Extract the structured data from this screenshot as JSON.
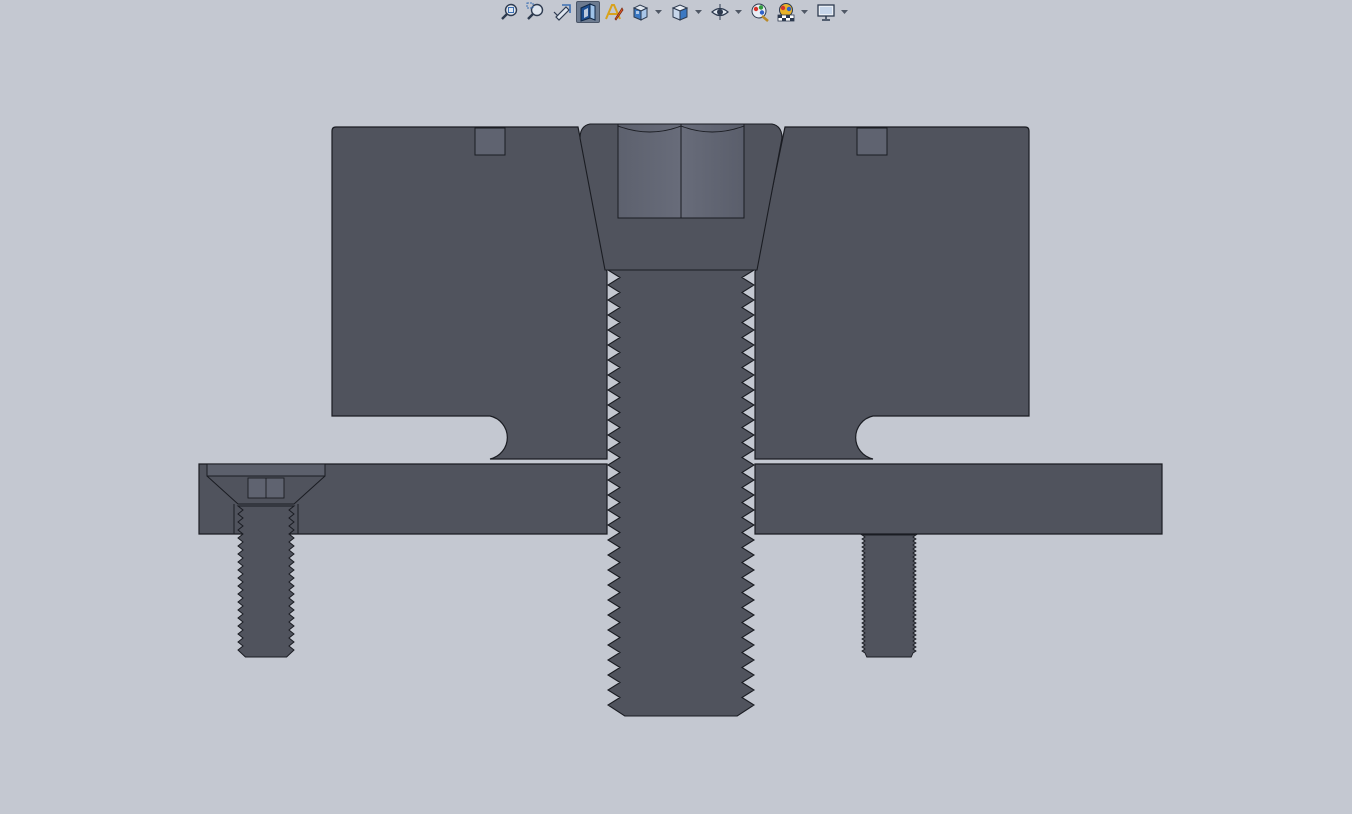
{
  "toolbar": {
    "buttons": [
      {
        "name": "zoom-to-fit-icon",
        "active": false,
        "dropdown": false
      },
      {
        "name": "zoom-to-area-icon",
        "active": false,
        "dropdown": false
      },
      {
        "name": "previous-view-icon",
        "active": false,
        "dropdown": false
      },
      {
        "name": "section-view-icon",
        "active": true,
        "dropdown": false
      },
      {
        "name": "dynamic-annotation-views-icon",
        "active": false,
        "dropdown": false
      },
      {
        "name": "view-orientation-icon",
        "active": false,
        "dropdown": true
      },
      {
        "name": "display-style-icon",
        "active": false,
        "dropdown": true
      },
      {
        "name": "hide-show-items-icon",
        "active": false,
        "dropdown": true
      },
      {
        "name": "edit-appearance-icon",
        "active": false,
        "dropdown": false
      },
      {
        "name": "apply-scene-icon",
        "active": false,
        "dropdown": true
      },
      {
        "name": "view-settings-icon",
        "active": false,
        "dropdown": true
      }
    ]
  },
  "colors": {
    "background": "#c4c8d1",
    "part_body": "#50535d",
    "part_edge": "#1a1c22",
    "socket_face": "#626674",
    "toolbar_active": "#6d7b90"
  }
}
